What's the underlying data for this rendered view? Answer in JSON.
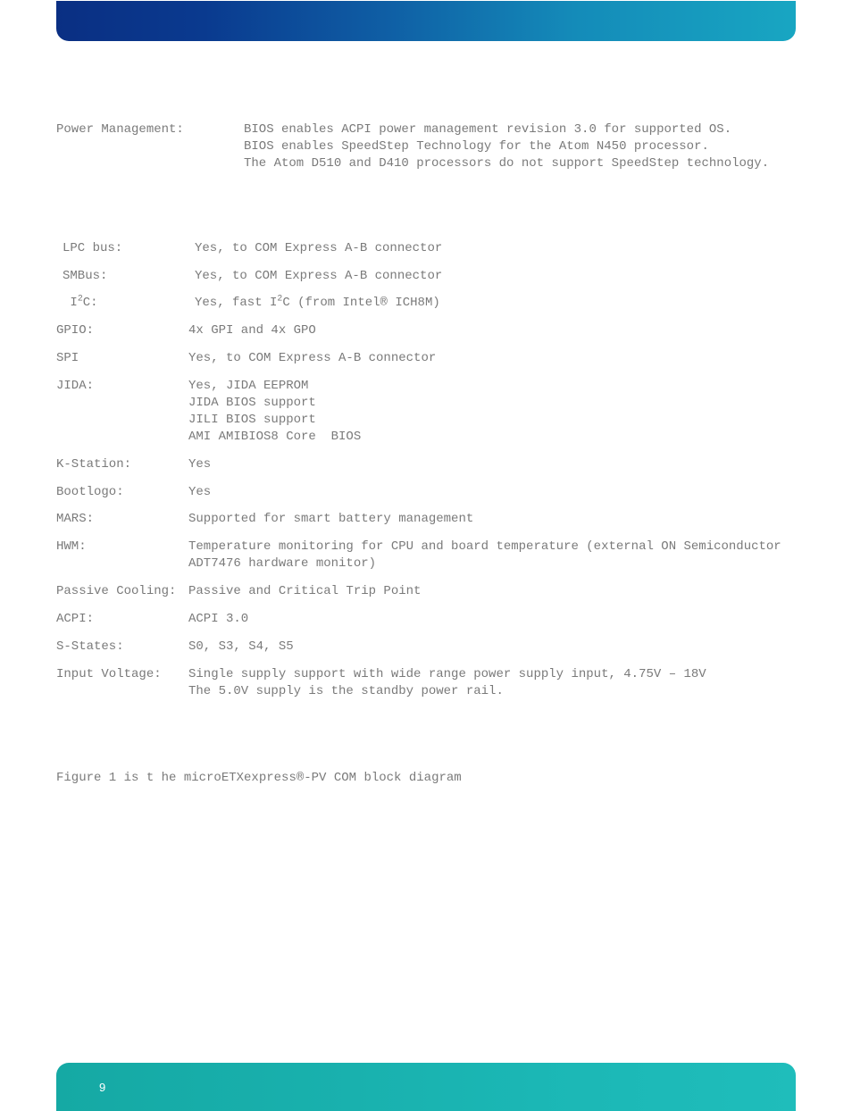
{
  "power_management": {
    "label": "Power Management:",
    "value": "BIOS enables ACPI power management revision 3.0 for supported OS.\nBIOS enables SpeedStep Technology for the Atom N450 processor.\nThe Atom D510 and D410 processors do not support SpeedStep technology."
  },
  "specs": {
    "lpc": {
      "label": "LPC bus:",
      "value": "Yes, to COM Express A-B connector"
    },
    "smbus": {
      "label": "SMBus:",
      "value": "Yes, to COM Express A-B connector"
    },
    "i2c": {
      "label_pre": " I",
      "label_sup": "2",
      "label_post": "C:",
      "value_pre": "Yes, fast I",
      "value_sup": "2",
      "value_post": "C (from Intel® ICH8M)"
    },
    "gpio": {
      "label": "GPIO:",
      "value": "4x GPI and 4x GPO"
    },
    "spi": {
      "label": "SPI",
      "value": "Yes, to COM Express A-B connector"
    },
    "jida": {
      "label": "JIDA:",
      "value": "Yes, JIDA EEPROM\nJIDA BIOS support\nJILI BIOS support\nAMI AMIBIOS8 Core  BIOS"
    },
    "kstation": {
      "label": "K-Station:",
      "value": "Yes"
    },
    "bootlogo": {
      "label": "Bootlogo:",
      "value": "Yes"
    },
    "mars": {
      "label": "MARS:",
      "value": "Supported for smart battery management"
    },
    "hwm": {
      "label": "HWM:",
      "value": "Temperature monitoring for CPU and board temperature (external ON Semiconductor ADT7476 hardware monitor)"
    },
    "passive": {
      "label": "Passive Cooling:",
      "value": "Passive and Critical Trip Point"
    },
    "acpi": {
      "label": "ACPI:",
      "value": "ACPI 3.0"
    },
    "sstates": {
      "label": "S-States:",
      "value": "S0, S3, S4, S5"
    },
    "inputv": {
      "label": "Input Voltage:",
      "value": "Single supply support with wide range power supply input, 4.75V – 18V\nThe 5.0V supply is the standby power rail."
    }
  },
  "figure_text": "Figure 1 is t he microETXexpress®-PV COM block diagram",
  "page_number": "9"
}
